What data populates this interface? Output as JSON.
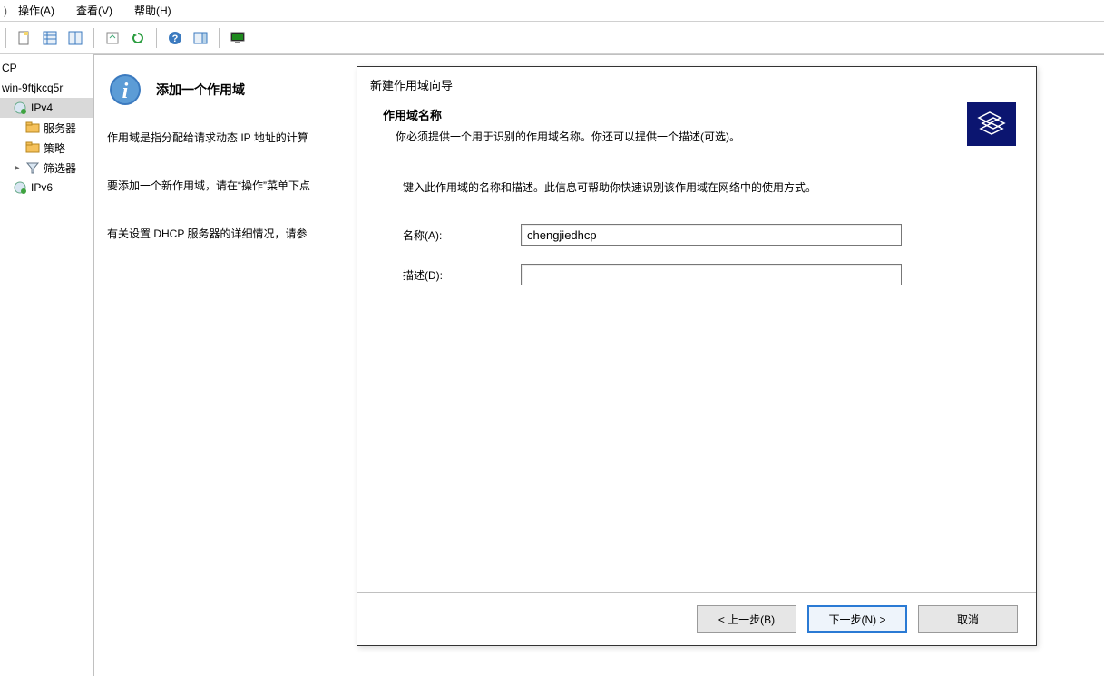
{
  "menubar": {
    "action": "操作(A)",
    "view": "查看(V)",
    "help": "帮助(H)"
  },
  "toolbar": {
    "icons": [
      "nav-back",
      "nav-fwd",
      "props",
      "list-view",
      "refresh-db",
      "export",
      "refresh",
      "help",
      "panel",
      "monitor"
    ]
  },
  "tree": {
    "root": "CP",
    "server": "win-9ftjkcq5r",
    "ipv4": "IPv4",
    "server_opts": "服务器",
    "policy": "策略",
    "filters": "筛选器",
    "ipv6": "IPv6"
  },
  "content": {
    "title": "添加一个作用域",
    "line1": "作用域是指分配给请求动态 IP 地址的计算",
    "line2": "要添加一个新作用域，请在“操作”菜单下点",
    "line3": "有关设置 DHCP 服务器的详细情况，请参"
  },
  "wizard": {
    "window_title": "新建作用域向导",
    "heading": "作用域名称",
    "subheading": "你必须提供一个用于识别的作用域名称。你还可以提供一个描述(可选)。",
    "instructions": "键入此作用域的名称和描述。此信息可帮助你快速识别该作用域在网络中的使用方式。",
    "name_label": "名称(A):",
    "name_value": "chengjiedhcp",
    "desc_label": "描述(D):",
    "desc_value": "",
    "back": "< 上一步(B)",
    "next": "下一步(N) >",
    "cancel": "取消"
  }
}
